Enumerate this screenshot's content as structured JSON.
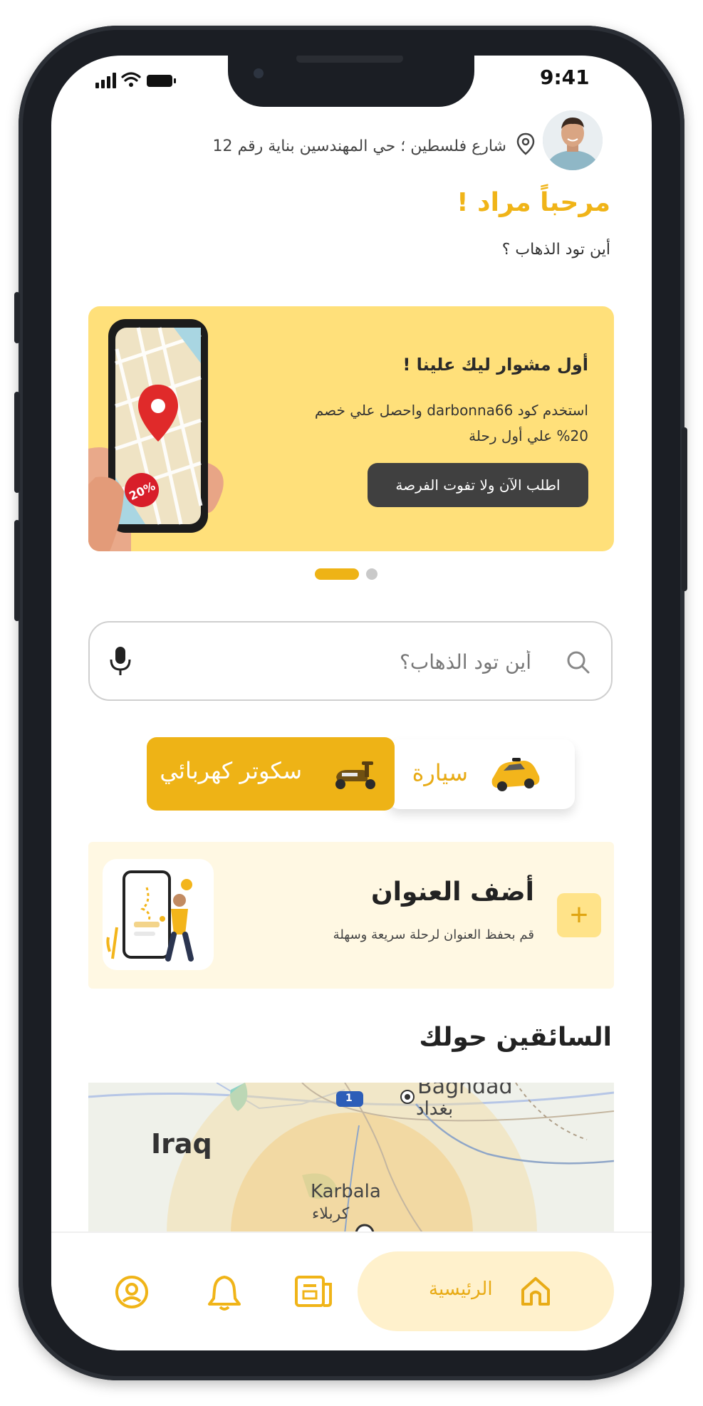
{
  "status_bar": {
    "time": "9:41"
  },
  "header": {
    "location": "شارع فلسطين ؛ حي المهندسين بناية رقم 12",
    "welcome": "مرحباً مراد !",
    "subtitle": "أين تود الذهاب ؟"
  },
  "promo": {
    "title": "أول مشوار ليك علينا !",
    "description": "استخدم كود darbonna66 واحصل علي خصم 20% علي أول رحلة",
    "button_label": "اطلب الآن ولا تفوت الفرصة",
    "badge": "20%",
    "active_dot": 0,
    "dot_count": 2
  },
  "search": {
    "placeholder": "أين تود الذهاب؟"
  },
  "vehicle_options": [
    {
      "label": "سيارة",
      "selected": false,
      "icon": "car-icon"
    },
    {
      "label": "سكوتر كهربائي",
      "selected": true,
      "icon": "scooter-icon"
    }
  ],
  "address_card": {
    "title": "أضف العنوان",
    "subtitle": "قم بحفظ العنوان لرحلة سريعة وسهلة"
  },
  "drivers": {
    "title": "السائقين حولك",
    "map_labels": {
      "country": "Iraq",
      "city1": "Baghdad",
      "city1_ar": "بغداد",
      "city2": "Karbala",
      "city2_ar": "كربلاء",
      "road": "1"
    }
  },
  "nav": {
    "home_label": "الرئيسية",
    "items": [
      "home-icon",
      "document-icon",
      "bell-icon",
      "profile-icon"
    ]
  },
  "colors": {
    "accent": "#eeb316",
    "promo_bg": "#ffe07a",
    "dark": "#404040"
  }
}
